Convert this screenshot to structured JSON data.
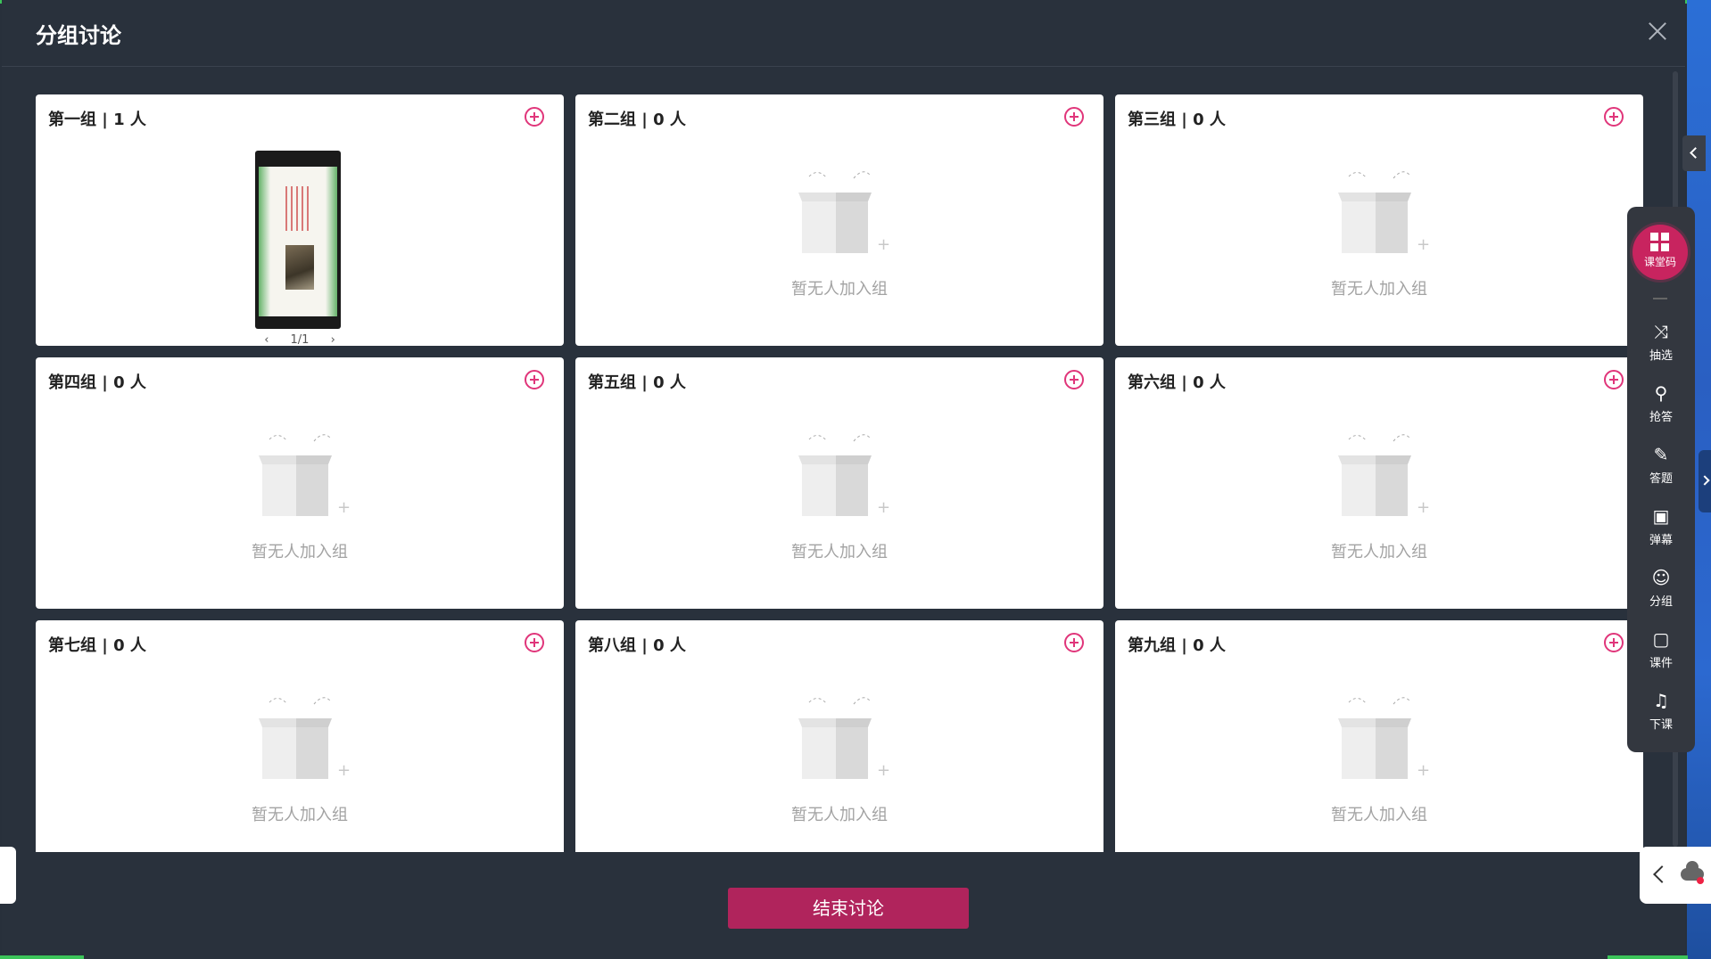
{
  "dialog": {
    "title": "分组讨论",
    "end_button_label": "结束讨论"
  },
  "groups": [
    {
      "title": "第一组 | 1 人",
      "empty_text": ""
    },
    {
      "title": "第二组 | 0 人",
      "empty_text": "暂无人加入组"
    },
    {
      "title": "第三组 | 0 人",
      "empty_text": "暂无人加入组"
    },
    {
      "title": "第四组 | 0 人",
      "empty_text": "暂无人加入组"
    },
    {
      "title": "第五组 | 0 人",
      "empty_text": "暂无人加入组"
    },
    {
      "title": "第六组 | 0 人",
      "empty_text": "暂无人加入组"
    },
    {
      "title": "第七组 | 0 人",
      "empty_text": "暂无人加入组"
    },
    {
      "title": "第八组 | 0 人",
      "empty_text": "暂无人加入组"
    },
    {
      "title": "第九组 | 0 人",
      "empty_text": "暂无人加入组"
    }
  ],
  "first_group_pager": "1/1",
  "toolbar": {
    "logo_label": "课堂码",
    "items": [
      {
        "label": "抽选",
        "icon": "shuffle-icon"
      },
      {
        "label": "抢答",
        "icon": "microphone-icon"
      },
      {
        "label": "答题",
        "icon": "pencil-icon"
      },
      {
        "label": "弹幕",
        "icon": "danmaku-icon"
      },
      {
        "label": "分组",
        "icon": "user-group-icon"
      },
      {
        "label": "课件",
        "icon": "courseware-icon"
      },
      {
        "label": "下课",
        "icon": "bell-icon"
      }
    ]
  },
  "colors": {
    "accent": "#b0245c",
    "plus": "#e0357a",
    "background": "#29313c"
  }
}
